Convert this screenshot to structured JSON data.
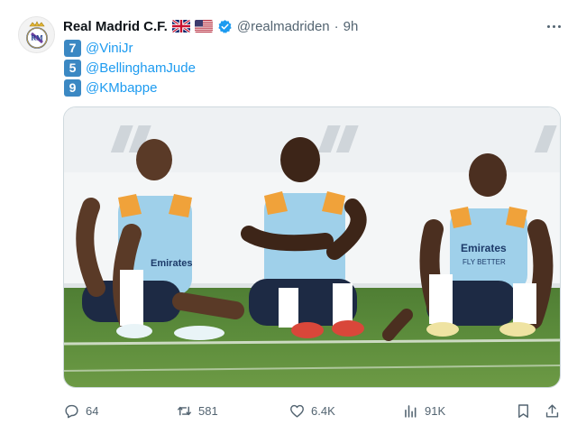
{
  "account": {
    "display_name": "Real Madrid C.F.",
    "handle": "@realmadriden",
    "separator": "·",
    "time": "9h",
    "verified": true,
    "avatar_icon": "real-madrid-crest"
  },
  "flags": [
    "uk-flag",
    "us-flag"
  ],
  "players": [
    {
      "number": "7",
      "mention": "@ViniJr"
    },
    {
      "number": "5",
      "mention": "@BellinghamJude"
    },
    {
      "number": "9",
      "mention": "@KMbappe"
    }
  ],
  "media": {
    "description_icon": "photo",
    "banner_text": [
      "Emirates",
      "FLY BETTER"
    ]
  },
  "actions": {
    "replies": "64",
    "reposts": "581",
    "likes": "6.4K",
    "views": "91K"
  },
  "colors": {
    "accent": "#1d9bf0",
    "badge": "#3b88c3",
    "muted": "#536471"
  }
}
